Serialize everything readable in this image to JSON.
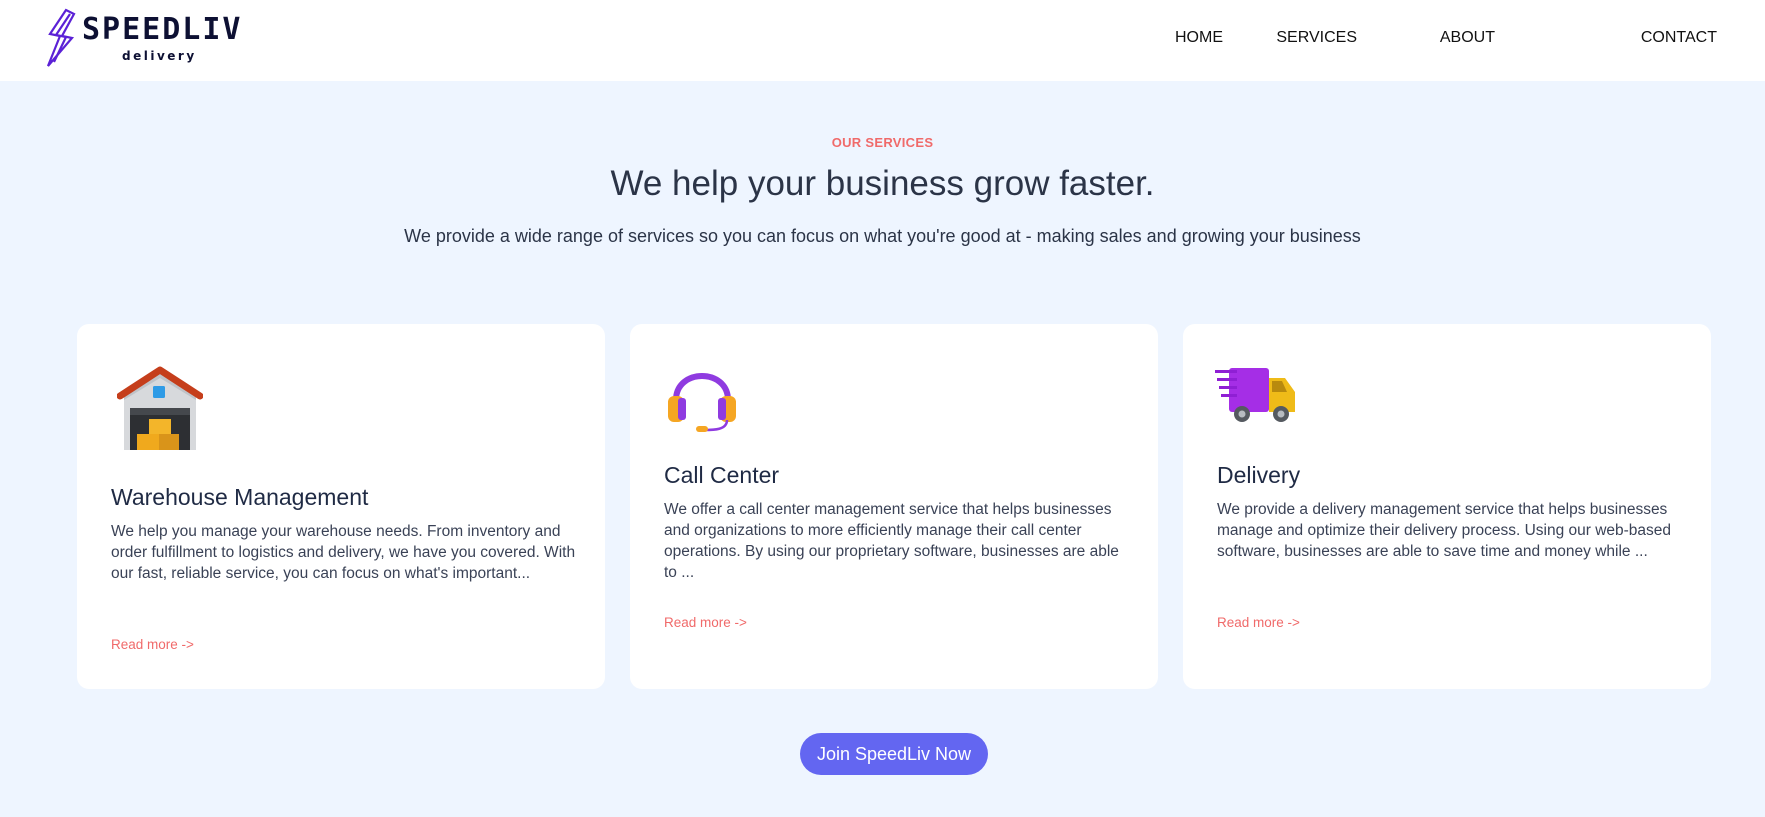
{
  "brand": {
    "name": "SPEEDLIV",
    "tagline": "delivery",
    "logo_color": "#5b21d6"
  },
  "nav": {
    "items": [
      {
        "label": "HOME"
      },
      {
        "label": "SERVICES"
      },
      {
        "label": "ABOUT"
      },
      {
        "label": "CONTACT"
      }
    ]
  },
  "services_section": {
    "eyebrow": "OUR SERVICES",
    "headline": "We help your business grow faster.",
    "subheadline": "We provide a wide range of services so you can focus on what you're good at - making sales and growing your business",
    "cards": [
      {
        "icon": "warehouse-icon",
        "title": "Warehouse Management",
        "description": "We help you manage your warehouse needs. From inventory and order fulfillment to logistics and delivery, we have you covered. With our fast, reliable service, you can focus on what's important...",
        "link_label": "Read more ->"
      },
      {
        "icon": "headset-icon",
        "title": "Call Center",
        "description": "We offer a call center management service that helps businesses and organizations to more efficiently manage their call center operations. By using our proprietary software, businesses are able to ...",
        "link_label": "Read more ->"
      },
      {
        "icon": "delivery-truck-icon",
        "title": "Delivery",
        "description": "We provide a delivery management service that helps businesses manage and optimize their delivery process. Using our web-based software, businesses are able to save time and money while ...",
        "link_label": "Read more ->"
      }
    ]
  },
  "cta": {
    "label": "Join SpeedLiv Now",
    "color": "#6366f1"
  },
  "colors": {
    "background": "#eef5ff",
    "accent": "#f06a6a",
    "text": "#2b3447"
  }
}
